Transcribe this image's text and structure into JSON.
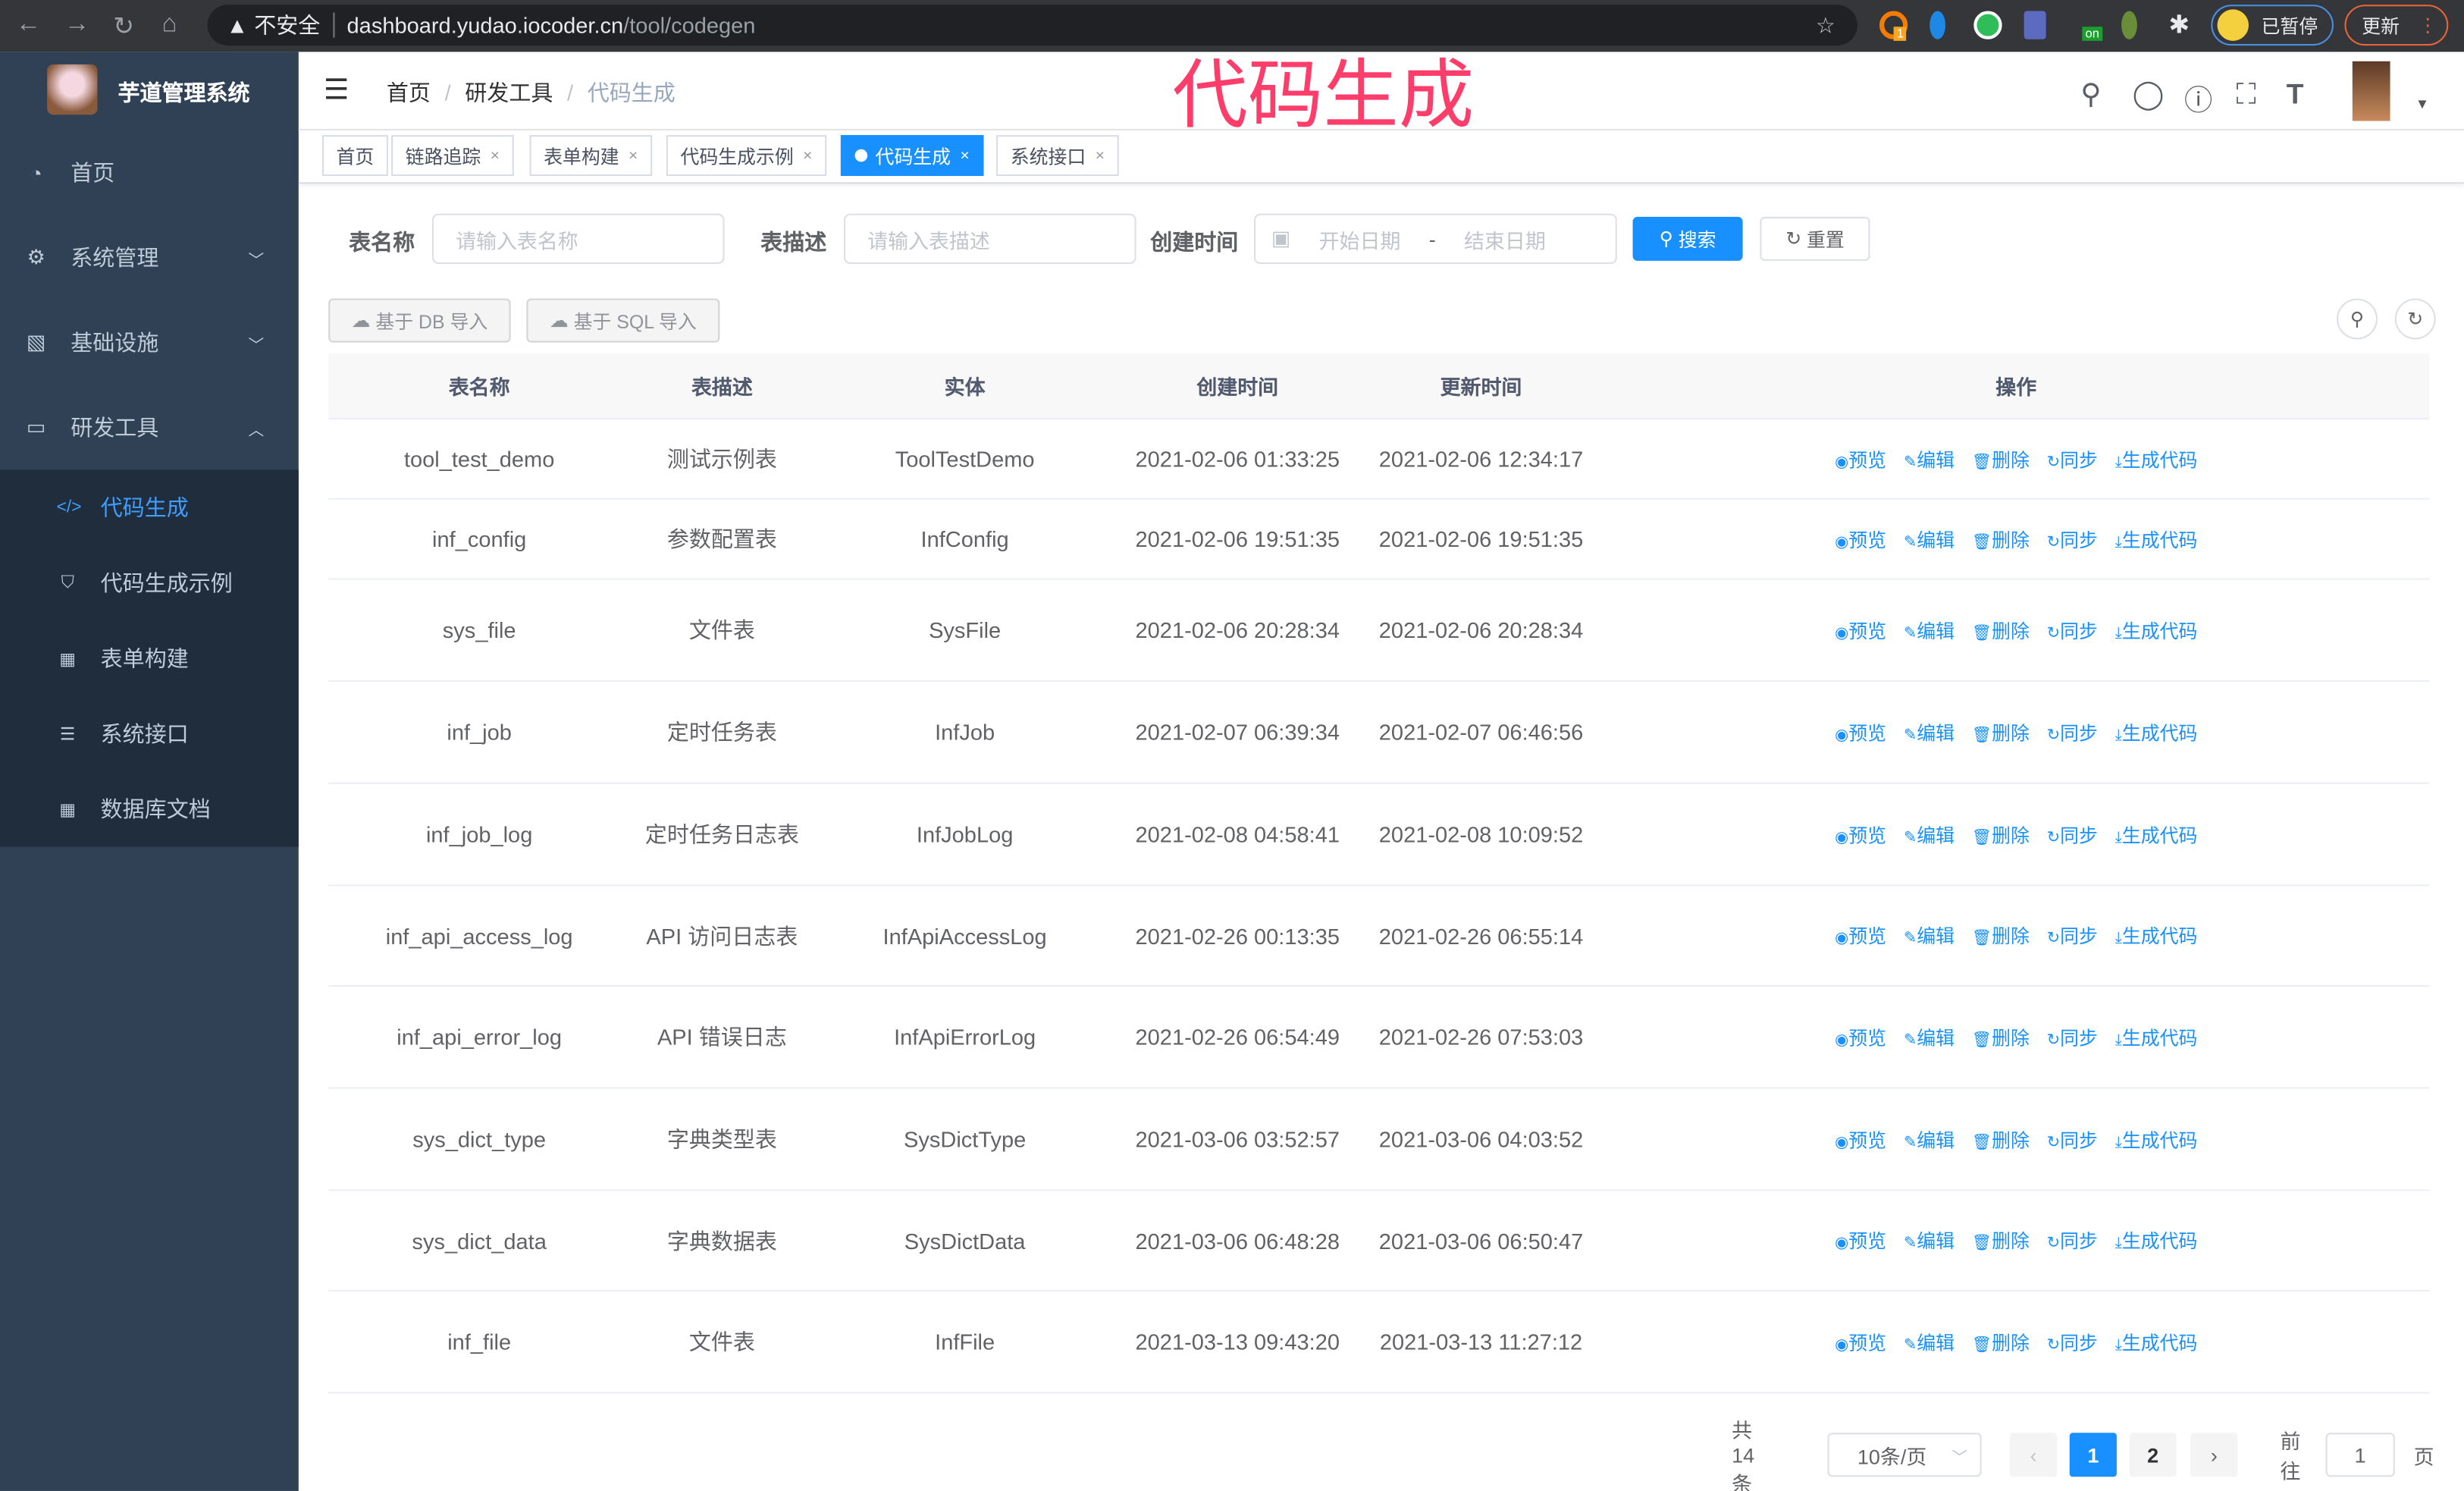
{
  "browser": {
    "security": "不安全",
    "url_host": "dashboard.yudao.iocoder.cn",
    "url_path": "/tool/codegen",
    "profile_label": "已暂停",
    "update_label": "更新",
    "ext_badge": "1",
    "ext_on": "on"
  },
  "overlay_title": "代码生成",
  "sidebar": {
    "brand": "芋道管理系统",
    "items": [
      {
        "label": "首页",
        "icon": "dashboard-icon"
      },
      {
        "label": "系统管理",
        "icon": "gear-icon"
      },
      {
        "label": "基础设施",
        "icon": "monitor-icon"
      },
      {
        "label": "研发工具",
        "icon": "toolbox-icon"
      }
    ],
    "sub_items": [
      {
        "label": "代码生成",
        "icon": "code-icon",
        "active": true
      },
      {
        "label": "代码生成示例",
        "icon": "shield-icon"
      },
      {
        "label": "表单构建",
        "icon": "form-icon"
      },
      {
        "label": "系统接口",
        "icon": "sliders-icon"
      },
      {
        "label": "数据库文档",
        "icon": "table-icon"
      }
    ]
  },
  "breadcrumb": [
    "首页",
    "研发工具",
    "代码生成"
  ],
  "tags": [
    {
      "label": "首页"
    },
    {
      "label": "链路追踪"
    },
    {
      "label": "表单构建"
    },
    {
      "label": "代码生成示例"
    },
    {
      "label": "代码生成",
      "active": true
    },
    {
      "label": "系统接口"
    }
  ],
  "search": {
    "name_label": "表名称",
    "name_placeholder": "请输入表名称",
    "desc_label": "表描述",
    "desc_placeholder": "请输入表描述",
    "time_label": "创建时间",
    "start_placeholder": "开始日期",
    "range_sep": "-",
    "end_placeholder": "结束日期",
    "search_btn": "搜索",
    "reset_btn": "重置"
  },
  "toolbar": {
    "import_db": "基于 DB 导入",
    "import_sql": "基于 SQL 导入"
  },
  "table": {
    "columns": [
      "表名称",
      "表描述",
      "实体",
      "创建时间",
      "更新时间",
      "操作"
    ],
    "actions": [
      "预览",
      "编辑",
      "删除",
      "同步",
      "生成代码"
    ],
    "rows": [
      [
        "tool_test_demo",
        "测试示例表",
        "ToolTestDemo",
        "2021-02-06 01:33:25",
        "2021-02-06 12:34:17"
      ],
      [
        "inf_config",
        "参数配置表",
        "InfConfig",
        "2021-02-06 19:51:35",
        "2021-02-06 19:51:35"
      ],
      [
        "sys_file",
        "文件表",
        "SysFile",
        "2021-02-06 20:28:34",
        "2021-02-06 20:28:34"
      ],
      [
        "inf_job",
        "定时任务表",
        "InfJob",
        "2021-02-07 06:39:34",
        "2021-02-07 06:46:56"
      ],
      [
        "inf_job_log",
        "定时任务日志表",
        "InfJobLog",
        "2021-02-08 04:58:41",
        "2021-02-08 10:09:52"
      ],
      [
        "inf_api_access_log",
        "API 访问日志表",
        "InfApiAccessLog",
        "2021-02-26 00:13:35",
        "2021-02-26 06:55:14"
      ],
      [
        "inf_api_error_log",
        "API 错误日志",
        "InfApiErrorLog",
        "2021-02-26 06:54:49",
        "2021-02-26 07:53:03"
      ],
      [
        "sys_dict_type",
        "字典类型表",
        "SysDictType",
        "2021-03-06 03:52:57",
        "2021-03-06 04:03:52"
      ],
      [
        "sys_dict_data",
        "字典数据表",
        "SysDictData",
        "2021-03-06 06:48:28",
        "2021-03-06 06:50:47"
      ],
      [
        "inf_file",
        "文件表",
        "InfFile",
        "2021-03-13 09:43:20",
        "2021-03-13 11:27:12"
      ]
    ]
  },
  "pagination": {
    "total": "共 14 条",
    "page_size": "10条/页",
    "pages": [
      "1",
      "2"
    ],
    "current_page": 1,
    "goto_label": "前往",
    "goto_value": "1",
    "page_unit": "页"
  },
  "colors": {
    "accent": "#1890ff",
    "sidebar_bg": "#304156",
    "submenu_bg": "#1f2d3d",
    "overlay": "#ff3d6a"
  }
}
